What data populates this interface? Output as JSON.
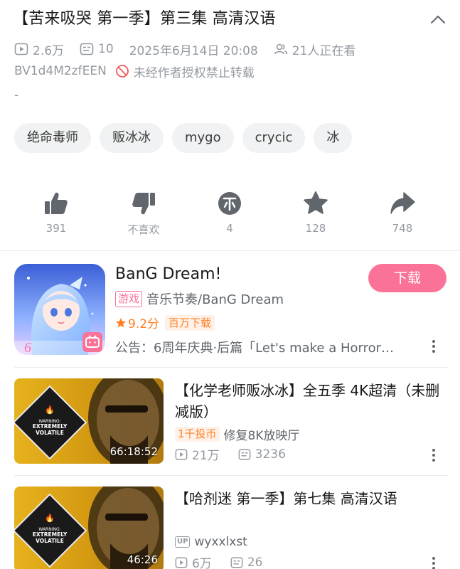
{
  "video": {
    "title": "【苦来吸哭 第一季】第三集 高清汉语",
    "views": "2.6万",
    "danmaku": "10",
    "date": "2025年6月14日 20:08",
    "watching": "21人正在看",
    "bvid": "BV1d4M2zfEEN",
    "copyright": "未经作者授权禁止转载",
    "description": "-"
  },
  "tags": [
    "绝命毒师",
    "贩冰冰",
    "mygo",
    "crycic",
    "冰"
  ],
  "actions": [
    {
      "label": "391",
      "icon": "thumbs-up-icon"
    },
    {
      "label": "不喜欢",
      "icon": "thumbs-down-icon"
    },
    {
      "label": "4",
      "icon": "coin-icon"
    },
    {
      "label": "128",
      "icon": "star-icon"
    },
    {
      "label": "748",
      "icon": "share-icon"
    }
  ],
  "app_card": {
    "name": "BanG Dream!",
    "category_tag": "游戏",
    "category": "音乐节奏/BanG Dream",
    "rating": "9.2分",
    "downloads": "百万下载",
    "notice": "公告：6周年庆典·后篇「Let's make a Horror…",
    "download_label": "下载",
    "icon_badge": "6"
  },
  "related": [
    {
      "title": "【化学老师贩冰冰】全五季 4K超清（未删减版）",
      "coin_tag": "1千投币",
      "subtitle": "修复8K放映厅",
      "duration": "66:18:52",
      "views": "21万",
      "danmaku": "3236",
      "thumb_text": "WARNING: EXTREMELY VOLATILE"
    },
    {
      "title": "【哈剂迷 第一季】第七集 高清汉语",
      "uploader": "wyxxlxst",
      "duration": "46:26",
      "views": "6万",
      "danmaku": "26",
      "thumb_text": "WARNING: EXTREMELY VOLATILE"
    }
  ],
  "colors": {
    "accent_pink": "#fb7299",
    "accent_orange": "#ff7f24",
    "muted_text": "#9499a0",
    "icon_gray": "#61666d"
  }
}
